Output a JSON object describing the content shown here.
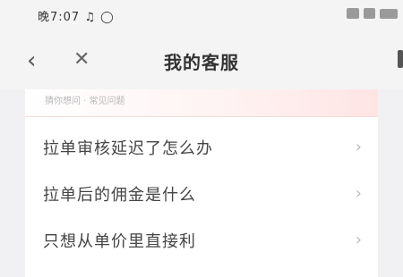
{
  "statusbar": {
    "left_text": "晚7:07 ♫ ◯",
    "right_icons": [
      "signal-icon",
      "wifi-icon",
      "battery-icon"
    ]
  },
  "navbar": {
    "back_glyph": "‹",
    "close_glyph": "✕",
    "title": "我的客服",
    "more_icon": "more-icon"
  },
  "card": {
    "header_text": "猜你想问 · 常见问题"
  },
  "faq": [
    {
      "question": "拉单审核延迟了怎么办"
    },
    {
      "question": "拉单后的佣金是什么"
    },
    {
      "question": "只想从单价里直接利"
    }
  ]
}
